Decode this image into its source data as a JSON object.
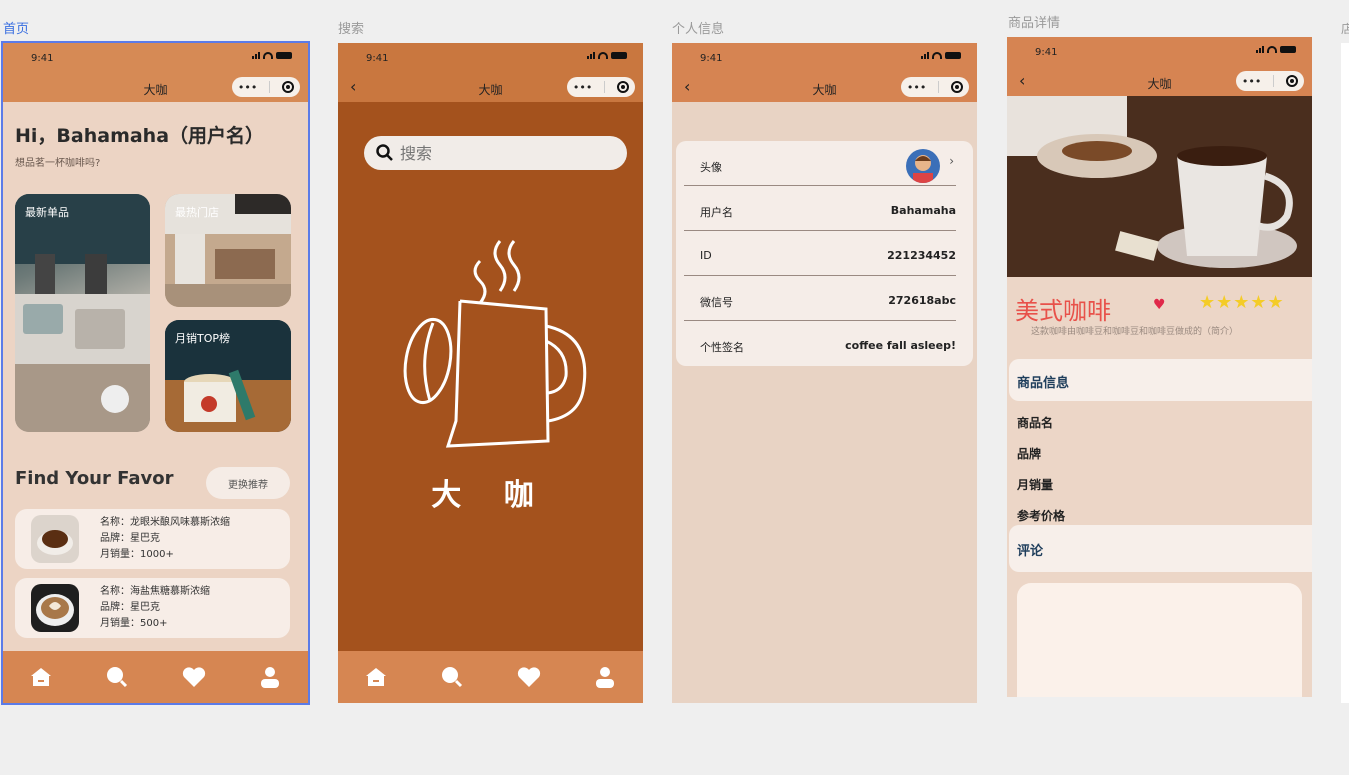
{
  "frames": {
    "home_label": "首页",
    "search_label": "搜索",
    "profile_label": "个人信息",
    "detail_label": "商品详情",
    "edge_label": "店"
  },
  "status": {
    "time": "9:41"
  },
  "nav": {
    "title": "大咖",
    "capsule_more": "•••"
  },
  "home": {
    "greeting": "Hi，Bahamaha（用户名）",
    "subtitle": "想品茗一杯咖啡吗?",
    "cards": {
      "newest": "最新单品",
      "hot_store": "最热门店",
      "top_monthly": "月销TOP榜"
    },
    "find_title": "Find Your Favor",
    "switch_label": "更换推荐",
    "recommendations": [
      {
        "name": "名称：龙眼米酿风味慕斯浓缩",
        "brand": "品牌：星巴克",
        "sales": "月销量：1000+"
      },
      {
        "name": "名称：海盐焦糖慕斯浓缩",
        "brand": "品牌：星巴克",
        "sales": "月销量：500+"
      }
    ]
  },
  "search": {
    "placeholder": "搜索",
    "logo_text": "大 咖"
  },
  "profile": {
    "rows": [
      {
        "key": "头像",
        "value": ""
      },
      {
        "key": "用户名",
        "value": "Bahamaha"
      },
      {
        "key": "ID",
        "value": "221234452"
      },
      {
        "key": "微信号",
        "value": "272618abc"
      },
      {
        "key": "个性签名",
        "value": "coffee fall asleep!"
      }
    ]
  },
  "detail": {
    "product_name": "美式咖啡",
    "stars": "★★★★★",
    "description": "这款咖啡由咖啡豆和咖啡豆和咖啡豆做成的（简介）",
    "info_section": "商品信息",
    "fields": [
      "商品名",
      "品牌",
      "月销量",
      "参考价格"
    ],
    "comments_section": "评论"
  },
  "colors": {
    "accent_home": "#d68a55",
    "search_bg": "#a4521d",
    "tabbar": "#d68652",
    "selected_outline": "#5b7be8",
    "star": "#f4cc28",
    "product_name": "#e8514a"
  },
  "icons": {
    "tabbar": [
      "home-icon",
      "search-icon",
      "heart-icon",
      "user-icon"
    ]
  }
}
